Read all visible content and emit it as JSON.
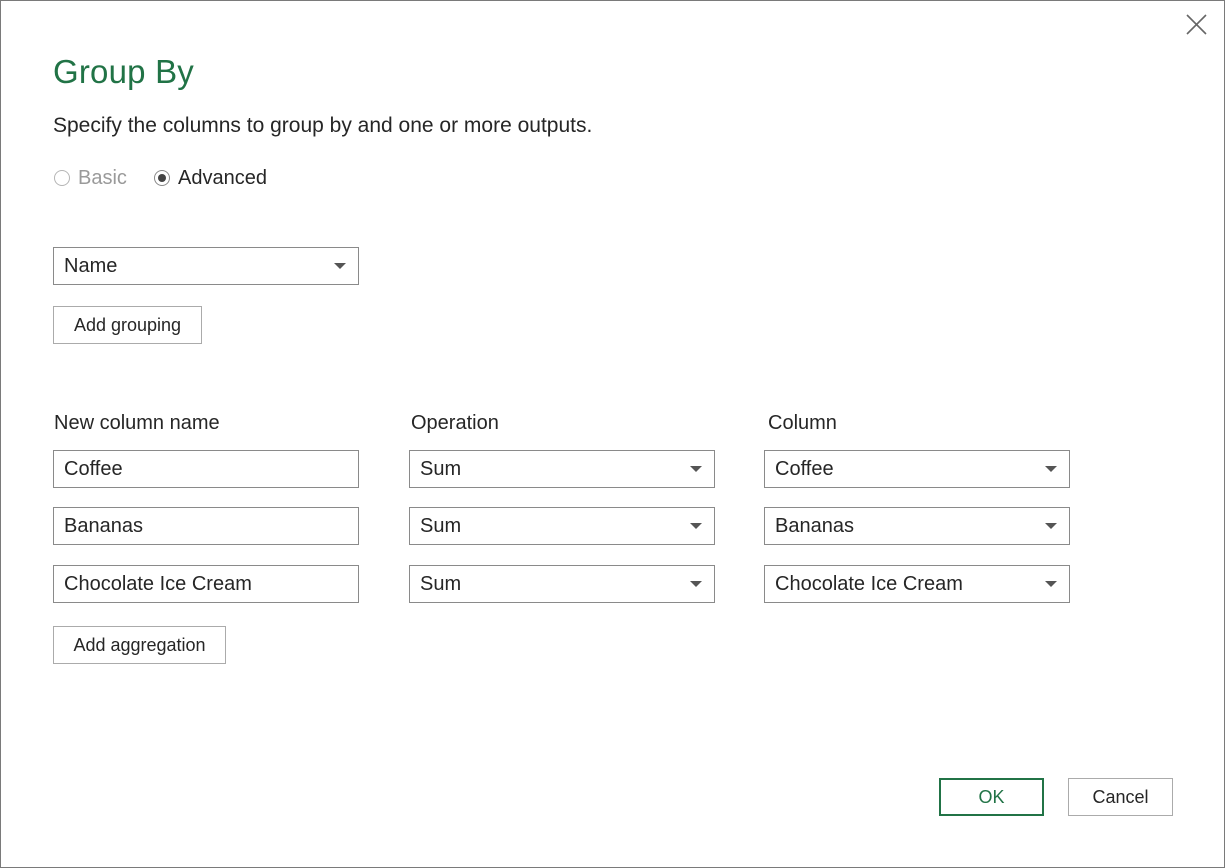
{
  "dialog": {
    "title": "Group By",
    "subtitle": "Specify the columns to group by and one or more outputs.",
    "mode": {
      "basic_label": "Basic",
      "advanced_label": "Advanced",
      "selected": "Advanced"
    },
    "grouping": {
      "column": "Name",
      "add_button": "Add grouping"
    },
    "aggregation_headers": {
      "new_column_name": "New column name",
      "operation": "Operation",
      "column": "Column"
    },
    "aggregations": [
      {
        "name": "Coffee",
        "operation": "Sum",
        "column": "Coffee"
      },
      {
        "name": "Bananas",
        "operation": "Sum",
        "column": "Bananas"
      },
      {
        "name": "Chocolate Ice Cream",
        "operation": "Sum",
        "column": "Chocolate Ice Cream"
      }
    ],
    "add_aggregation_button": "Add aggregation",
    "ok_button": "OK",
    "cancel_button": "Cancel",
    "icons": {
      "close": "close-icon",
      "dropdown": "chevron-down-icon"
    },
    "colors": {
      "accent": "#217346",
      "border": "#8a8a8a"
    }
  }
}
